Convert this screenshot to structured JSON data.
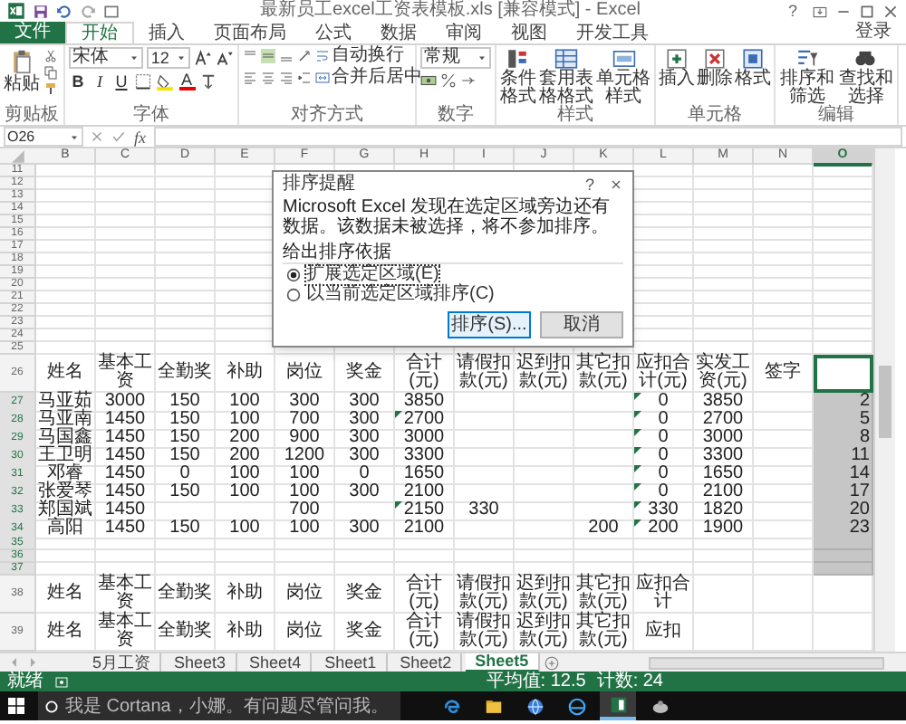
{
  "window": {
    "title": "最新员工excel工资表模板.xls [兼容模式] - Excel",
    "help": "?"
  },
  "ribbon_tabs": [
    {
      "label": "文件",
      "kind": "file",
      "selected": false
    },
    {
      "label": "开始",
      "kind": "tab",
      "selected": true
    },
    {
      "label": "插入",
      "kind": "tab",
      "selected": false
    },
    {
      "label": "页面布局",
      "kind": "tab",
      "selected": false
    },
    {
      "label": "公式",
      "kind": "tab",
      "selected": false
    },
    {
      "label": "数据",
      "kind": "tab",
      "selected": false
    },
    {
      "label": "审阅",
      "kind": "tab",
      "selected": false
    },
    {
      "label": "视图",
      "kind": "tab",
      "selected": false
    },
    {
      "label": "开发工具",
      "kind": "tab",
      "selected": false
    }
  ],
  "account": "登录",
  "ribbon_groups": [
    {
      "kind": "clipboard",
      "label": "剪贴板",
      "paste": "粘贴"
    },
    {
      "kind": "font",
      "label": "字体",
      "font_name": "宋体",
      "font_size": "12",
      "style_buttons": [
        "B",
        "I",
        "U"
      ],
      "font_color_button": "A"
    },
    {
      "kind": "alignment",
      "label": "对齐方式",
      "wrap_text": "自动换行",
      "merge_center": "合并后居中"
    },
    {
      "kind": "number",
      "label": "数字",
      "format": "常规"
    },
    {
      "kind": "buttons",
      "label": "样式",
      "buttons": [
        "条件格式",
        "套用表格格式",
        "单元格样式"
      ]
    },
    {
      "kind": "buttons",
      "label": "单元格",
      "buttons": [
        "插入",
        "删除",
        "格式"
      ]
    },
    {
      "kind": "buttons",
      "label": "编辑",
      "buttons": [
        "排序和筛选",
        "查找和选择"
      ]
    }
  ],
  "formula_bar": {
    "name_box": "O26",
    "function_label": "fx"
  },
  "columns": [
    {
      "label": "B",
      "selected": false
    },
    {
      "label": "C",
      "selected": false
    },
    {
      "label": "D",
      "selected": false
    },
    {
      "label": "E",
      "selected": false
    },
    {
      "label": "F",
      "selected": false
    },
    {
      "label": "G",
      "selected": false
    },
    {
      "label": "H",
      "selected": false
    },
    {
      "label": "I",
      "selected": false
    },
    {
      "label": "J",
      "selected": false
    },
    {
      "label": "K",
      "selected": false
    },
    {
      "label": "L",
      "selected": false
    },
    {
      "label": "M",
      "selected": false
    },
    {
      "label": "N",
      "selected": false
    },
    {
      "label": "O",
      "selected": true
    }
  ],
  "rows": [
    {
      "number": "11",
      "kind": "blank"
    },
    {
      "number": "12",
      "kind": "blank"
    },
    {
      "number": "13",
      "kind": "blank"
    },
    {
      "number": "14",
      "kind": "blank"
    },
    {
      "number": "15",
      "kind": "blank"
    },
    {
      "number": "16",
      "kind": "blank"
    },
    {
      "number": "17",
      "kind": "blank"
    },
    {
      "number": "18",
      "kind": "blank"
    },
    {
      "number": "19",
      "kind": "blank"
    },
    {
      "number": "20",
      "kind": "blank"
    },
    {
      "number": "21",
      "kind": "blank"
    },
    {
      "number": "22",
      "kind": "blank"
    },
    {
      "number": "23",
      "kind": "blank"
    },
    {
      "number": "24",
      "kind": "blank"
    },
    {
      "number": "25",
      "kind": "blank"
    },
    {
      "number": "26",
      "kind": "header",
      "cells": [
        "姓名",
        "基本工资",
        "全勤奖",
        "补助",
        "岗位",
        "奖金",
        "合计(元)",
        "请假扣款(元)",
        "迟到扣款(元)",
        "其它扣款(元)",
        "应扣合计(元)",
        "实发工资(元)",
        "签字"
      ],
      "o_cell": {
        "active": true
      }
    },
    {
      "number": "27",
      "kind": "data",
      "cells": [
        "马亚茹",
        "3000",
        "150",
        "100",
        "300",
        "300",
        "3850",
        null,
        null,
        null,
        "0",
        "3850",
        null
      ],
      "h_flag": false,
      "l_flag": true,
      "o_cell": {
        "text": "2",
        "selected": true,
        "active": false
      }
    },
    {
      "number": "28",
      "kind": "data",
      "cells": [
        "马亚南",
        "1450",
        "150",
        "100",
        "700",
        "300",
        "2700",
        null,
        null,
        null,
        "0",
        "2700",
        null
      ],
      "h_flag": true,
      "l_flag": true,
      "o_cell": {
        "text": "5",
        "selected": true,
        "active": false
      }
    },
    {
      "number": "29",
      "kind": "data",
      "cells": [
        "马国鑫",
        "1450",
        "150",
        "200",
        "900",
        "300",
        "3000",
        null,
        null,
        null,
        "0",
        "3000",
        null
      ],
      "h_flag": false,
      "l_flag": true,
      "o_cell": {
        "text": "8",
        "selected": true,
        "active": false
      }
    },
    {
      "number": "30",
      "kind": "data",
      "cells": [
        "王卫明",
        "1450",
        "150",
        "200",
        "1200",
        "300",
        "3300",
        null,
        null,
        null,
        "0",
        "3300",
        null
      ],
      "h_flag": false,
      "l_flag": true,
      "o_cell": {
        "text": "11",
        "selected": true,
        "active": false
      }
    },
    {
      "number": "31",
      "kind": "data",
      "cells": [
        "邓睿",
        "1450",
        "0",
        "100",
        "100",
        "0",
        "1650",
        null,
        null,
        null,
        "0",
        "1650",
        null
      ],
      "h_flag": false,
      "l_flag": true,
      "o_cell": {
        "text": "14",
        "selected": true,
        "active": false
      }
    },
    {
      "number": "32",
      "kind": "data",
      "cells": [
        "张爱琴",
        "1450",
        "150",
        "100",
        "100",
        "300",
        "2100",
        null,
        null,
        null,
        "0",
        "2100",
        null
      ],
      "h_flag": false,
      "l_flag": true,
      "o_cell": {
        "text": "17",
        "selected": true,
        "active": false
      }
    },
    {
      "number": "33",
      "kind": "data",
      "cells": [
        "郑国斌",
        "1450",
        null,
        null,
        "700",
        null,
        "2150",
        "330",
        null,
        null,
        "330",
        "1820",
        null
      ],
      "h_flag": true,
      "l_flag": true,
      "o_cell": {
        "text": "20",
        "selected": true,
        "active": false
      }
    },
    {
      "number": "34",
      "kind": "data",
      "cells": [
        "高阳",
        "1450",
        "150",
        "100",
        "100",
        "300",
        "2100",
        null,
        null,
        "200",
        "200",
        "1900",
        null
      ],
      "h_flag": false,
      "l_flag": true,
      "o_cell": {
        "text": "23",
        "selected": true,
        "active": false
      }
    },
    {
      "number": "35",
      "kind": "blank",
      "o_cell": {
        "selected": true,
        "active": false
      }
    },
    {
      "number": "36",
      "kind": "blank",
      "o_cell": {
        "selected": true,
        "active": false
      }
    },
    {
      "number": "37",
      "kind": "blank",
      "o_cell": {
        "selected": true,
        "active": false
      }
    },
    {
      "number": "38",
      "kind": "header",
      "cells": [
        "姓名",
        "基本工资",
        "全勤奖",
        "补助",
        "岗位",
        "奖金",
        "合计(元)",
        "请假扣款(元)",
        "迟到扣款(元)",
        "其它扣款(元)",
        "应扣合计",
        null,
        null
      ]
    },
    {
      "number": "39",
      "kind": "header",
      "cells": [
        "姓名",
        "基本工资",
        "全勤奖",
        "补助",
        "岗位",
        "奖金",
        "合计(元)",
        "请假扣款(元)",
        "迟到扣款(元)",
        "其它扣款(元)",
        "应扣",
        null,
        null
      ]
    }
  ],
  "dialog": {
    "title": "排序提醒",
    "help": "?",
    "message": "Microsoft Excel 发现在选定区域旁边还有数据。该数据未被选择，将不参加排序。",
    "prompt": "给出排序依据",
    "options": [
      {
        "label": "扩展选定区域(E)",
        "selected": true
      },
      {
        "label": "以当前选定区域排序(C)",
        "selected": false
      }
    ],
    "buttons": [
      {
        "label": "排序(S)...",
        "kind": "primary"
      },
      {
        "label": "取消",
        "kind": "normal"
      }
    ]
  },
  "sheet_tabs": [
    {
      "label": "5月工资",
      "selected": false
    },
    {
      "label": "Sheet3",
      "selected": false
    },
    {
      "label": "Sheet4",
      "selected": false
    },
    {
      "label": "Sheet1",
      "selected": false
    },
    {
      "label": "Sheet2",
      "selected": false
    },
    {
      "label": "Sheet5",
      "selected": true
    }
  ],
  "status_bar": {
    "mode": "就绪",
    "average": "平均值: 12.5",
    "count": "计数: 24"
  },
  "taskbar": {
    "search_placeholder": "我是 Cortana，小娜。有问题尽管问我。",
    "apps": [
      {
        "kind": "edge",
        "active": false
      },
      {
        "kind": "folder",
        "active": false
      },
      {
        "kind": "globe",
        "active": false
      },
      {
        "kind": "browser",
        "active": false
      },
      {
        "kind": "excel",
        "active": true
      },
      {
        "kind": "game",
        "active": false
      }
    ]
  }
}
